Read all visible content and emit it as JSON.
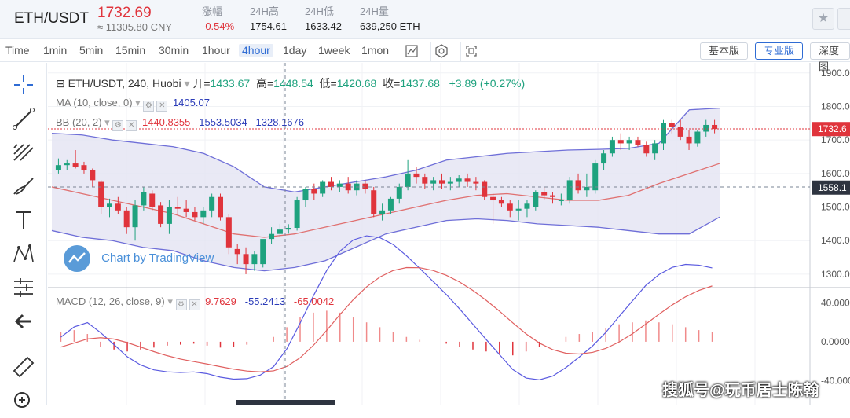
{
  "header": {
    "pair": "ETH/USDT",
    "price": "1732.69",
    "price_cny": "≈ 11305.80 CNY",
    "stats": [
      {
        "label": "涨幅",
        "value": "-0.54%",
        "negative": true
      },
      {
        "label": "24H高",
        "value": "1754.61"
      },
      {
        "label": "24H低",
        "value": "1633.42"
      },
      {
        "label": "24H量",
        "value": "639,250 ETH"
      }
    ]
  },
  "toolbar": {
    "timeframes": [
      "Time",
      "1min",
      "5min",
      "15min",
      "30min",
      "1hour",
      "4hour",
      "1day",
      "1week",
      "1mon"
    ],
    "active_timeframe": "4hour",
    "icons": [
      "line-chart-icon",
      "settings-hex-icon",
      "fullscreen-icon"
    ],
    "versions": [
      "基本版",
      "专业版",
      "深度图"
    ],
    "active_version": "专业版"
  },
  "left_tools": [
    "crosshair-icon",
    "trend-line-icon",
    "fib-icon",
    "brush-icon",
    "text-icon",
    "pattern-icon",
    "measure-icon",
    "back-arrow-icon",
    "ruler-icon",
    "zoom-icon"
  ],
  "legend": {
    "symbol": "ETH/USDT, 240, Huobi",
    "open_label": "开=",
    "open": "1433.67",
    "high_label": "高=",
    "high": "1448.54",
    "low_label": "低=",
    "low": "1420.68",
    "close_label": "收=",
    "close": "1437.68",
    "change": "+3.89 (+0.27%)"
  },
  "indicators": {
    "ma": {
      "label": "MA (10, close, 0)",
      "value": "1405.07"
    },
    "bb": {
      "label": "BB (20, 2)",
      "basis": "1440.8355",
      "upper": "1553.5034",
      "lower": "1328.1676"
    },
    "macd": {
      "label": "MACD (12, 26, close, 9)",
      "hist": "9.7629",
      "macd": "-55.2413",
      "signal": "-65.0042"
    }
  },
  "price_axis": {
    "ticks": [
      "1900.00",
      "1800.00",
      "1700.00",
      "1600.00",
      "1500.00",
      "1400.00",
      "1300.00"
    ],
    "current_price_tag": "1732.6",
    "crosshair_price_tag": "1558.1"
  },
  "macd_axis": {
    "ticks": [
      "40.0000",
      "0.0000",
      "-40.0000"
    ]
  },
  "branding": {
    "tradingview": "Chart by TradingView",
    "watermark": "搜狐号@玩币居士陈翰"
  },
  "colors": {
    "up": "#1ea27e",
    "down": "#e0343c",
    "band_fill": "#e4e4f2",
    "band_line": "#6f6fd8",
    "ma_line": "#e07070",
    "accent": "#2f6cd4"
  },
  "chart_data": {
    "type": "candlestick",
    "y_range": [
      1260,
      1930
    ],
    "candles": [
      [
        1610,
        1645,
        1600,
        1625
      ],
      [
        1625,
        1640,
        1610,
        1630
      ],
      [
        1630,
        1670,
        1615,
        1620
      ],
      [
        1625,
        1635,
        1600,
        1610
      ],
      [
        1610,
        1615,
        1560,
        1580
      ],
      [
        1575,
        1580,
        1480,
        1500
      ],
      [
        1500,
        1525,
        1470,
        1510
      ],
      [
        1510,
        1530,
        1480,
        1490
      ],
      [
        1490,
        1500,
        1420,
        1440
      ],
      [
        1440,
        1520,
        1400,
        1505
      ],
      [
        1505,
        1560,
        1490,
        1545
      ],
      [
        1540,
        1550,
        1490,
        1500
      ],
      [
        1505,
        1515,
        1440,
        1450
      ],
      [
        1450,
        1520,
        1420,
        1500
      ],
      [
        1500,
        1530,
        1480,
        1495
      ],
      [
        1495,
        1520,
        1470,
        1485
      ],
      [
        1485,
        1500,
        1460,
        1470
      ],
      [
        1470,
        1500,
        1450,
        1490
      ],
      [
        1490,
        1540,
        1470,
        1530
      ],
      [
        1530,
        1540,
        1460,
        1470
      ],
      [
        1470,
        1480,
        1360,
        1380
      ],
      [
        1375,
        1390,
        1330,
        1360
      ],
      [
        1360,
        1380,
        1300,
        1330
      ],
      [
        1330,
        1370,
        1310,
        1360
      ],
      [
        1330,
        1400,
        1320,
        1405
      ],
      [
        1405,
        1440,
        1390,
        1420
      ],
      [
        1420,
        1450,
        1410,
        1433
      ],
      [
        1433,
        1449,
        1421,
        1438
      ],
      [
        1438,
        1530,
        1430,
        1520
      ],
      [
        1520,
        1560,
        1500,
        1555
      ],
      [
        1555,
        1570,
        1520,
        1540
      ],
      [
        1540,
        1580,
        1530,
        1575
      ],
      [
        1575,
        1590,
        1550,
        1560
      ],
      [
        1560,
        1580,
        1545,
        1570
      ],
      [
        1570,
        1590,
        1540,
        1550
      ],
      [
        1550,
        1580,
        1535,
        1570
      ],
      [
        1570,
        1580,
        1540,
        1555
      ],
      [
        1550,
        1560,
        1470,
        1480
      ],
      [
        1480,
        1510,
        1460,
        1490
      ],
      [
        1490,
        1530,
        1480,
        1525
      ],
      [
        1525,
        1570,
        1510,
        1560
      ],
      [
        1560,
        1640,
        1550,
        1600
      ],
      [
        1600,
        1620,
        1570,
        1590
      ],
      [
        1590,
        1600,
        1555,
        1570
      ],
      [
        1570,
        1590,
        1550,
        1580
      ],
      [
        1580,
        1600,
        1555,
        1570
      ],
      [
        1570,
        1590,
        1550,
        1575
      ],
      [
        1575,
        1595,
        1560,
        1585
      ],
      [
        1585,
        1600,
        1560,
        1575
      ],
      [
        1575,
        1590,
        1550,
        1570
      ],
      [
        1575,
        1580,
        1520,
        1530
      ],
      [
        1530,
        1540,
        1450,
        1520
      ],
      [
        1520,
        1530,
        1500,
        1510
      ],
      [
        1510,
        1520,
        1470,
        1490
      ],
      [
        1490,
        1520,
        1460,
        1495
      ],
      [
        1495,
        1520,
        1470,
        1510
      ],
      [
        1500,
        1550,
        1490,
        1545
      ],
      [
        1545,
        1560,
        1520,
        1535
      ],
      [
        1535,
        1545,
        1510,
        1530
      ],
      [
        1520,
        1540,
        1505,
        1520
      ],
      [
        1520,
        1590,
        1510,
        1580
      ],
      [
        1580,
        1600,
        1540,
        1550
      ],
      [
        1550,
        1600,
        1530,
        1560
      ],
      [
        1550,
        1640,
        1540,
        1630
      ],
      [
        1630,
        1670,
        1610,
        1660
      ],
      [
        1660,
        1710,
        1650,
        1700
      ],
      [
        1700,
        1720,
        1670,
        1690
      ],
      [
        1690,
        1710,
        1670,
        1700
      ],
      [
        1700,
        1710,
        1680,
        1685
      ],
      [
        1685,
        1695,
        1650,
        1660
      ],
      [
        1660,
        1700,
        1640,
        1690
      ],
      [
        1690,
        1760,
        1670,
        1750
      ],
      [
        1750,
        1760,
        1720,
        1740
      ],
      [
        1740,
        1760,
        1700,
        1710
      ],
      [
        1710,
        1730,
        1670,
        1690
      ],
      [
        1690,
        1730,
        1680,
        1725
      ],
      [
        1725,
        1760,
        1710,
        1745
      ],
      [
        1745,
        1760,
        1720,
        1733
      ]
    ],
    "bb_upper": [
      1720,
      1715,
      1700,
      1690,
      1680,
      1660,
      1620,
      1560,
      1545,
      1560,
      1575,
      1590,
      1610,
      1640,
      1650,
      1660,
      1665,
      1670,
      1672,
      1675,
      1690,
      1790,
      1795
    ],
    "bb_lower": [
      1430,
      1410,
      1400,
      1380,
      1370,
      1340,
      1320,
      1310,
      1320,
      1340,
      1380,
      1420,
      1440,
      1460,
      1465,
      1460,
      1450,
      1445,
      1440,
      1430,
      1420,
      1420,
      1470
    ],
    "ma": [
      1560,
      1540,
      1520,
      1500,
      1480,
      1450,
      1420,
      1410,
      1420,
      1440,
      1460,
      1480,
      1500,
      1520,
      1535,
      1540,
      1530,
      1520,
      1520,
      1535,
      1570,
      1600,
      1630
    ],
    "macd_hist": [
      10,
      12,
      8,
      -5,
      -8,
      -10,
      -8,
      -6,
      -4,
      -3,
      -2,
      -4,
      -6,
      -5,
      -3,
      0,
      5,
      15,
      25,
      30,
      32,
      30,
      25,
      20,
      15,
      10,
      5,
      2,
      0,
      -2,
      -5,
      -8,
      -10,
      -12,
      -14,
      -10,
      -5,
      0,
      5,
      8,
      10,
      14,
      18,
      20,
      22,
      20,
      18,
      15,
      12,
      10
    ]
  }
}
